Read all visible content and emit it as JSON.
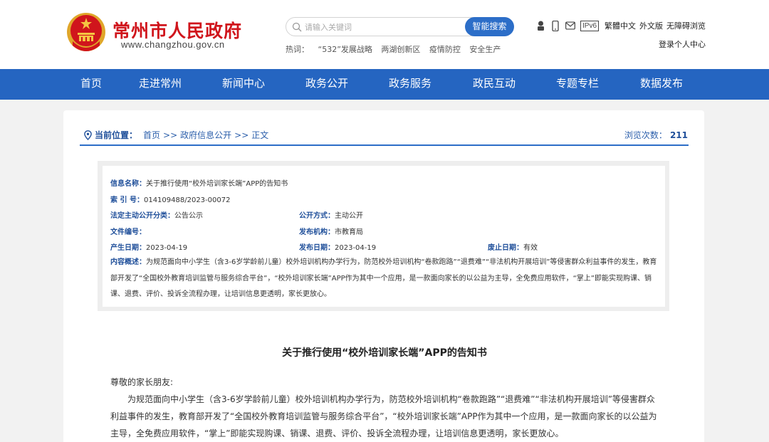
{
  "header": {
    "site_name": "常州市人民政府",
    "site_url": "www.changzhou.gov.cn",
    "search_placeholder": "请输入关键词",
    "search_button": "智能搜索",
    "hot_label": "热词：",
    "hot_words": [
      "“532”发展战略",
      "两湖创新区",
      "疫情防控",
      "安全生产"
    ],
    "ipv6": "IPv6",
    "links": [
      "繁體中文",
      "外文版",
      "无障碍浏览"
    ],
    "login": "登录个人中心"
  },
  "nav": [
    "首页",
    "走进常州",
    "新闻中心",
    "政务公开",
    "政务服务",
    "政民互动",
    "专题专栏",
    "数据发布"
  ],
  "breadcrumb": {
    "label": "当前位置：",
    "items": [
      "首页",
      ">>",
      "政府信息公开",
      ">>",
      "正文"
    ]
  },
  "views": {
    "label": "浏览次数：",
    "count": "211"
  },
  "info": {
    "name_key": "信息名称：",
    "name_val": "关于推行使用“校外培训家长端”APP的告知书",
    "index_key": "索 引 号：",
    "index_val": "014109488/2023-00072",
    "category_key": "法定主动公开分类：",
    "category_val": "公告公示",
    "mode_key": "公开方式：",
    "mode_val": "主动公开",
    "docno_key": "文件编号：",
    "docno_val": "",
    "org_key": "发布机构：",
    "org_val": "市教育局",
    "created_key": "产生日期：",
    "created_val": "2023-04-19",
    "published_key": "发布日期：",
    "published_val": "2023-04-19",
    "expiry_key": "废止日期：",
    "expiry_val": "有效",
    "summary_key": "内容概述：",
    "summary_val": "为规范面向中小学生（含3-6岁学龄前儿童）校外培训机构办学行为，防范校外培训机构“卷款跑路”“退费难”“非法机构开展培训”等侵害群众利益事件的发生，教育部开发了“全国校外教育培训监管与服务综合平台”，“校外培训家长端”APP作为其中一个应用，是一款面向家长的以公益为主导，全免费应用软件，“掌上”即能实现购课、销课、退费、评价、投诉全流程办理，让培训信息更透明，家长更放心。"
  },
  "article": {
    "title": "关于推行使用“校外培训家长端”APP的告知书",
    "greeting": "尊敬的家长朋友:",
    "paragraph": "为规范面向中小学生（含3-6岁学龄前儿童）校外培训机构办学行为，防范校外培训机构“卷款跑路”“退费难”“非法机构开展培训”等侵害群众利益事件的发生，教育部开发了“全国校外教育培训监管与服务综合平台”，“校外培训家长端”APP作为其中一个应用，是一款面向家长的以公益为主导，全免费应用软件，“掌上”即能实现购课、销课、退费、评价、投诉全流程办理，让培训信息更透明，家长更放心。"
  },
  "colors": {
    "brand_red": "#d0151c",
    "nav_blue": "#2565c1",
    "accent_blue": "#2c6ec8"
  }
}
